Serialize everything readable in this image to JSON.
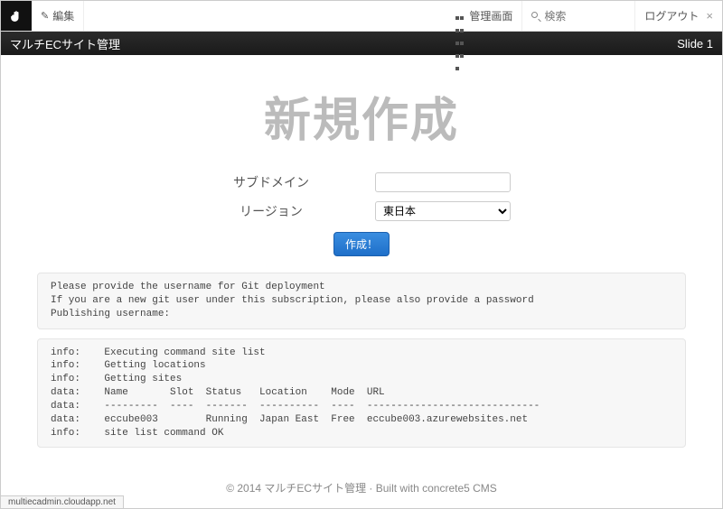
{
  "toolbar": {
    "edit_label": "編集",
    "admin_label": "管理画面",
    "search_placeholder": "検索",
    "logout_label": "ログアウト"
  },
  "blackbar": {
    "title": "マルチECサイト管理",
    "slide": "Slide 1"
  },
  "heading": "新規作成",
  "form": {
    "subdomain_label": "サブドメイン",
    "subdomain_value": "",
    "region_label": "リージョン",
    "region_selected": "東日本",
    "submit_label": "作成！"
  },
  "message1": "Please provide the username for Git deployment\nIf you are a new git user under this subscription, please also provide a password\nPublishing username:",
  "message2": "info:    Executing command site list\ninfo:    Getting locations\ninfo:    Getting sites\ndata:    Name       Slot  Status   Location    Mode  URL\ndata:    ---------  ----  -------  ----------  ----  -----------------------------\ndata:    eccube003        Running  Japan East  Free  eccube003.azurewebsites.net\ninfo:    site list command OK",
  "footer": "© 2014 マルチECサイト管理 · Built with concrete5 CMS",
  "status_bar": "multiecadmin.cloudapp.net"
}
